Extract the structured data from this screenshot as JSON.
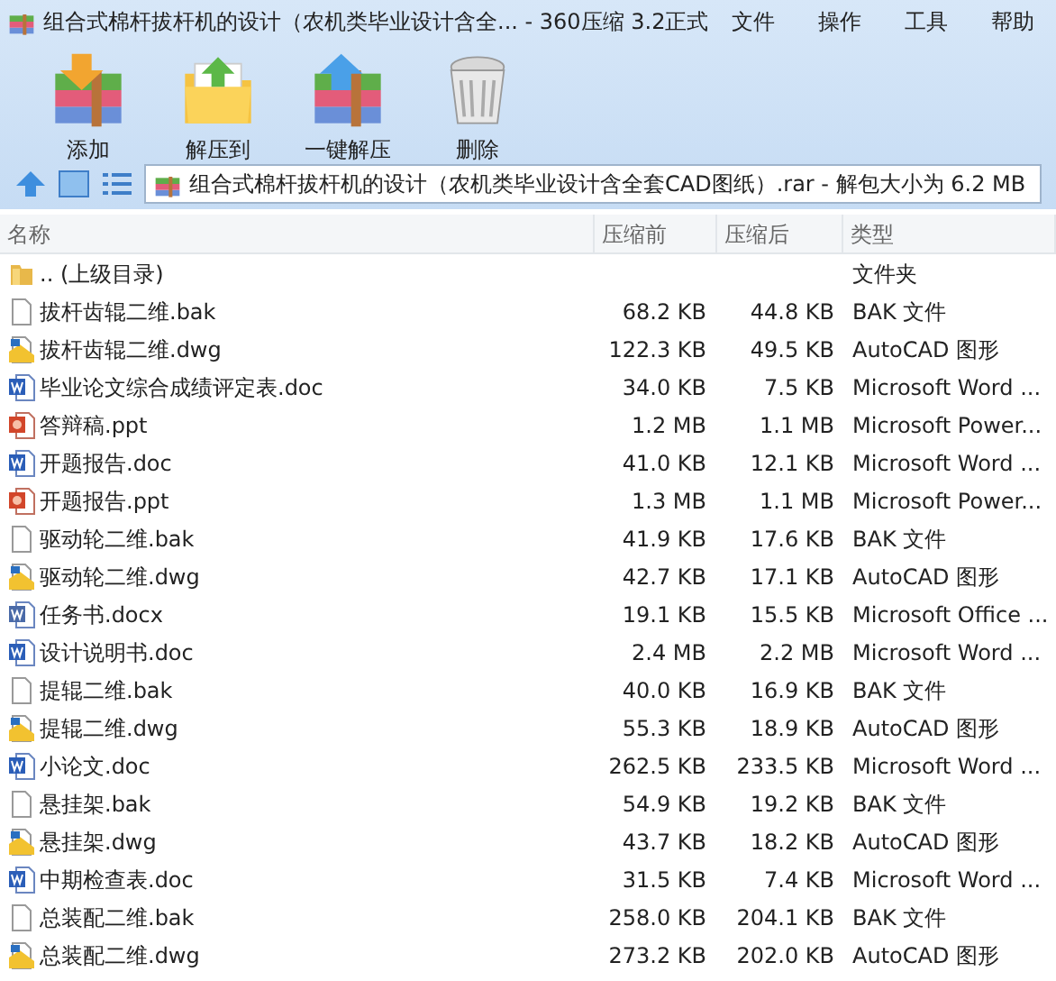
{
  "window": {
    "title": "组合式棉杆拔杆机的设计（农机类毕业设计含全... - 360压缩 3.2正式"
  },
  "menu": [
    "文件",
    "操作",
    "工具",
    "帮助"
  ],
  "toolbar": [
    {
      "label": "添加",
      "kind": "add"
    },
    {
      "label": "解压到",
      "kind": "extract"
    },
    {
      "label": "一键解压",
      "kind": "quick"
    },
    {
      "label": "删除",
      "kind": "delete"
    }
  ],
  "address": {
    "value": "组合式棉杆拔杆机的设计（农机类毕业设计含全套CAD图纸）.rar - 解包大小为 6.2 MB"
  },
  "table": {
    "columns": [
      "名称",
      "压缩前",
      "压缩后",
      "类型"
    ],
    "rows": [
      {
        "kind": "folder",
        "name": ".. (上级目录)",
        "type": "文件夹"
      },
      {
        "kind": "blank",
        "name": "拔杆齿辊二维.bak",
        "before": "68.2 KB",
        "after": "44.8 KB",
        "type": "BAK 文件"
      },
      {
        "kind": "dwg",
        "name": "拔杆齿辊二维.dwg",
        "before": "122.3 KB",
        "after": "49.5 KB",
        "type": "AutoCAD 图形"
      },
      {
        "kind": "word",
        "name": "毕业论文综合成绩评定表.doc",
        "before": "34.0 KB",
        "after": "7.5 KB",
        "type": "Microsoft Word ..."
      },
      {
        "kind": "ppt",
        "name": "答辩稿.ppt",
        "before": "1.2 MB",
        "after": "1.1 MB",
        "type": "Microsoft Power..."
      },
      {
        "kind": "word",
        "name": "开题报告.doc",
        "before": "41.0 KB",
        "after": "12.1 KB",
        "type": "Microsoft Word ..."
      },
      {
        "kind": "ppt",
        "name": "开题报告.ppt",
        "before": "1.3 MB",
        "after": "1.1 MB",
        "type": "Microsoft Power..."
      },
      {
        "kind": "blank",
        "name": "驱动轮二维.bak",
        "before": "41.9 KB",
        "after": "17.6 KB",
        "type": "BAK 文件"
      },
      {
        "kind": "dwg",
        "name": "驱动轮二维.dwg",
        "before": "42.7 KB",
        "after": "17.1 KB",
        "type": "AutoCAD 图形"
      },
      {
        "kind": "docx",
        "name": "任务书.docx",
        "before": "19.1 KB",
        "after": "15.5 KB",
        "type": "Microsoft Office ..."
      },
      {
        "kind": "word",
        "name": "设计说明书.doc",
        "before": "2.4 MB",
        "after": "2.2 MB",
        "type": "Microsoft Word ..."
      },
      {
        "kind": "blank",
        "name": "提辊二维.bak",
        "before": "40.0 KB",
        "after": "16.9 KB",
        "type": "BAK 文件"
      },
      {
        "kind": "dwg",
        "name": "提辊二维.dwg",
        "before": "55.3 KB",
        "after": "18.9 KB",
        "type": "AutoCAD 图形"
      },
      {
        "kind": "word",
        "name": "小论文.doc",
        "before": "262.5 KB",
        "after": "233.5 KB",
        "type": "Microsoft Word ..."
      },
      {
        "kind": "blank",
        "name": "悬挂架.bak",
        "before": "54.9 KB",
        "after": "19.2 KB",
        "type": "BAK 文件"
      },
      {
        "kind": "dwg",
        "name": "悬挂架.dwg",
        "before": "43.7 KB",
        "after": "18.2 KB",
        "type": "AutoCAD 图形"
      },
      {
        "kind": "word",
        "name": "中期检查表.doc",
        "before": "31.5 KB",
        "after": "7.4 KB",
        "type": "Microsoft Word ..."
      },
      {
        "kind": "blank",
        "name": "总装配二维.bak",
        "before": "258.0 KB",
        "after": "204.1 KB",
        "type": "BAK 文件"
      },
      {
        "kind": "dwg",
        "name": "总装配二维.dwg",
        "before": "273.2 KB",
        "after": "202.0 KB",
        "type": "AutoCAD 图形"
      }
    ]
  }
}
